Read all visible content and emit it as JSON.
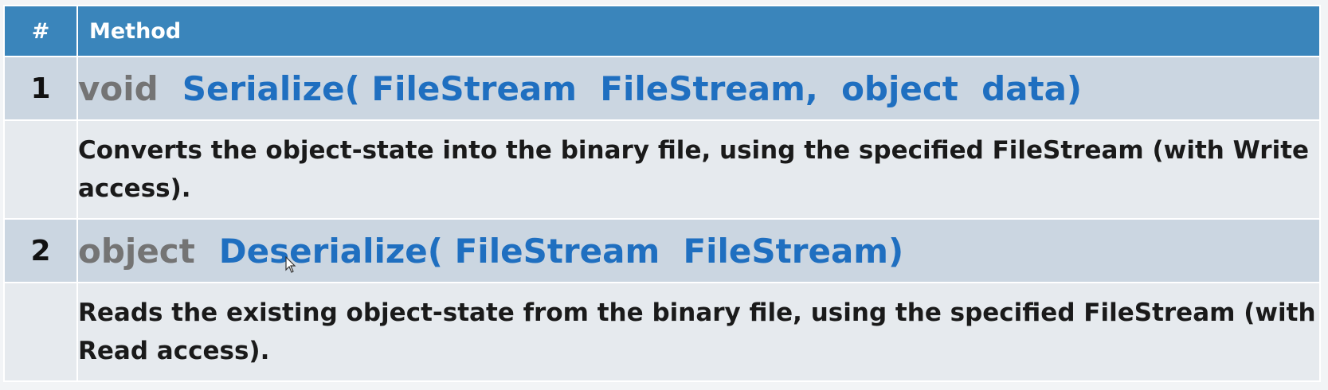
{
  "table": {
    "header": {
      "num": "#",
      "method": "Method"
    },
    "rows": [
      {
        "num": "1",
        "return_type": "void",
        "signature": "Serialize( FileStream  FileStream,  object  data)",
        "description": "Converts the object-state into the binary file, using the specified FileStream (with Write access)."
      },
      {
        "num": "2",
        "return_type": "object",
        "signature": "Deserialize( FileStream  FileStream)",
        "description": "Reads the existing object-state from the binary file, using the specified FileStream (with Read access)."
      }
    ]
  },
  "colors": {
    "header_bg": "#3a85bb",
    "signature_row_bg": "#cbd6e1",
    "description_row_bg": "#e6eaee",
    "return_type": "#747474",
    "method_name": "#1f6fc0"
  },
  "icons": {
    "cursor": "mouse-pointer-icon"
  }
}
